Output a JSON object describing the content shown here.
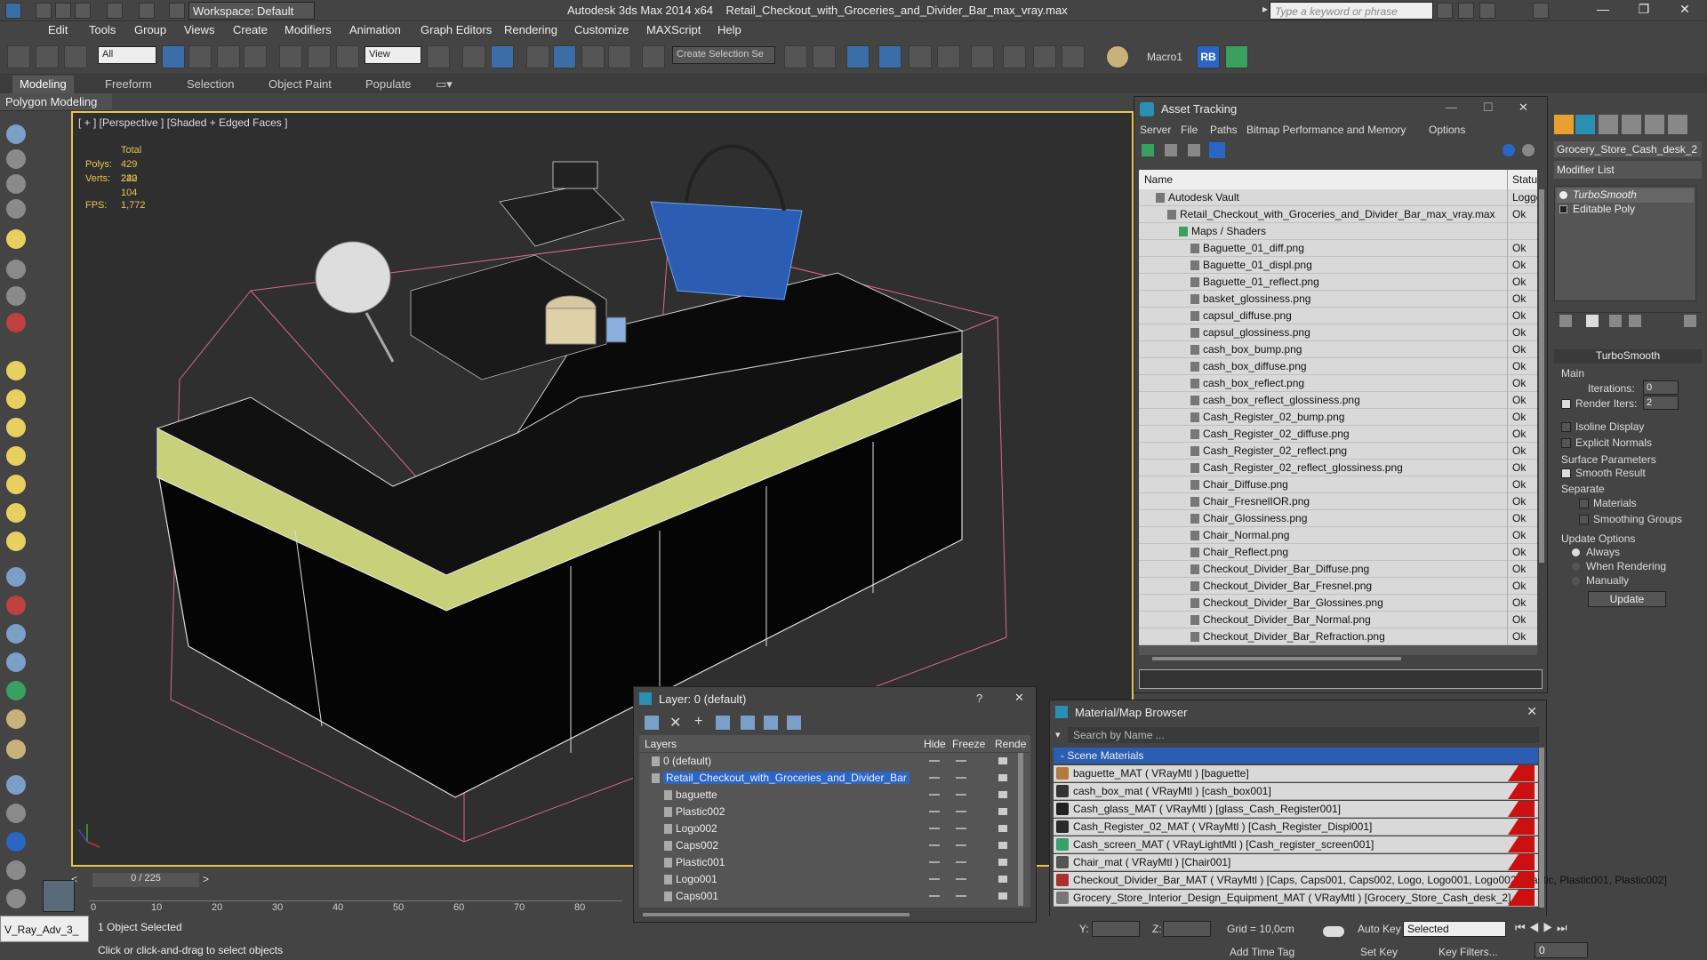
{
  "titlebar": {
    "app_title": "Autodesk 3ds Max  2014 x64",
    "file_title": "Retail_Checkout_with_Groceries_and_Divider_Bar_max_vray.max",
    "workspace": "Workspace: Default",
    "search_placeholder": "Type a keyword or phrase"
  },
  "menu": [
    "Edit",
    "Tools",
    "Group",
    "Views",
    "Create",
    "Modifiers",
    "Animation",
    "Graph Editors",
    "Rendering",
    "Customize",
    "MAXScript",
    "Help"
  ],
  "toolbar": {
    "selection_filter": "All",
    "ref_coord": "View",
    "named_selection_placeholder": "Create Selection Se",
    "macro_label": "Macro1",
    "rb_label": "RB"
  },
  "ribbon": {
    "tabs": [
      "Modeling",
      "Freeform",
      "Selection",
      "Object Paint",
      "Populate"
    ],
    "subtab": "Polygon Modeling"
  },
  "viewport": {
    "label": "[ + ] [Perspective ] [Shaded + Edged Faces ]",
    "stats_total": "Total",
    "polys_label": "Polys:",
    "polys_value": "429 242",
    "verts_label": "Verts:",
    "verts_value": "220 104",
    "fps_label": "FPS:",
    "fps_value": "1,772"
  },
  "asset_tracking": {
    "title": "Asset Tracking",
    "menu": [
      "Server",
      "File",
      "Paths",
      "Bitmap Performance and Memory",
      "Options"
    ],
    "col_name": "Name",
    "col_status": "Status",
    "rows": [
      {
        "name": "Autodesk Vault",
        "status": "Logge",
        "indent": 1
      },
      {
        "name": "Retail_Checkout_with_Groceries_and_Divider_Bar_max_vray.max",
        "status": "Ok",
        "indent": 2
      },
      {
        "name": "Maps / Shaders",
        "status": "",
        "indent": 3
      },
      {
        "name": "Baguette_01_diff.png",
        "status": "Ok",
        "indent": 4
      },
      {
        "name": "Baguette_01_displ.png",
        "status": "Ok",
        "indent": 4
      },
      {
        "name": "Baguette_01_reflect.png",
        "status": "Ok",
        "indent": 4
      },
      {
        "name": "basket_glossiness.png",
        "status": "Ok",
        "indent": 4
      },
      {
        "name": "capsul_diffuse.png",
        "status": "Ok",
        "indent": 4
      },
      {
        "name": "capsul_glossiness.png",
        "status": "Ok",
        "indent": 4
      },
      {
        "name": "cash_box_bump.png",
        "status": "Ok",
        "indent": 4
      },
      {
        "name": "cash_box_diffuse.png",
        "status": "Ok",
        "indent": 4
      },
      {
        "name": "cash_box_reflect.png",
        "status": "Ok",
        "indent": 4
      },
      {
        "name": "cash_box_reflect_glossiness.png",
        "status": "Ok",
        "indent": 4
      },
      {
        "name": "Cash_Register_02_bump.png",
        "status": "Ok",
        "indent": 4
      },
      {
        "name": "Cash_Register_02_diffuse.png",
        "status": "Ok",
        "indent": 4
      },
      {
        "name": "Cash_Register_02_reflect.png",
        "status": "Ok",
        "indent": 4
      },
      {
        "name": "Cash_Register_02_reflect_glossiness.png",
        "status": "Ok",
        "indent": 4
      },
      {
        "name": "Chair_Diffuse.png",
        "status": "Ok",
        "indent": 4
      },
      {
        "name": "Chair_FresnelIOR.png",
        "status": "Ok",
        "indent": 4
      },
      {
        "name": "Chair_Glossiness.png",
        "status": "Ok",
        "indent": 4
      },
      {
        "name": "Chair_Normal.png",
        "status": "Ok",
        "indent": 4
      },
      {
        "name": "Chair_Reflect.png",
        "status": "Ok",
        "indent": 4
      },
      {
        "name": "Checkout_Divider_Bar_Diffuse.png",
        "status": "Ok",
        "indent": 4
      },
      {
        "name": "Checkout_Divider_Bar_Fresnel.png",
        "status": "Ok",
        "indent": 4
      },
      {
        "name": "Checkout_Divider_Bar_Glossines.png",
        "status": "Ok",
        "indent": 4
      },
      {
        "name": "Checkout_Divider_Bar_Normal.png",
        "status": "Ok",
        "indent": 4
      },
      {
        "name": "Checkout_Divider_Bar_Refraction.png",
        "status": "Ok",
        "indent": 4
      }
    ]
  },
  "command_panel": {
    "object_name": "Grocery_Store_Cash_desk_2",
    "modifier_list": "Modifier List",
    "stack": [
      "TurboSmooth",
      "Editable Poly"
    ],
    "turbosmooth_title": "TurboSmooth",
    "main_label": "Main",
    "iterations_label": "Iterations:",
    "iterations_value": "0",
    "render_iters_label": "Render Iters:",
    "render_iters_value": "2",
    "isoline_label": "Isoline Display",
    "explicit_label": "Explicit Normals",
    "surface_label": "Surface Parameters",
    "smooth_label": "Smooth Result",
    "separate_label": "Separate",
    "materials_label": "Materials",
    "smoothing_label": "Smoothing Groups",
    "update_options_label": "Update Options",
    "always_label": "Always",
    "when_rendering_label": "When Rendering",
    "manually_label": "Manually",
    "update_button": "Update"
  },
  "layer_dialog": {
    "title": "Layer: 0 (default)",
    "help": "?",
    "col_layers": "Layers",
    "col_hide": "Hide",
    "col_freeze": "Freeze",
    "col_render": "Rende",
    "rows": [
      {
        "name": "0 (default)",
        "indent": 1,
        "selected": false
      },
      {
        "name": "Retail_Checkout_with_Groceries_and_Divider_Bar",
        "indent": 1,
        "selected": true
      },
      {
        "name": "baguette",
        "indent": 2,
        "selected": false
      },
      {
        "name": "Plastic002",
        "indent": 2,
        "selected": false
      },
      {
        "name": "Logo002",
        "indent": 2,
        "selected": false
      },
      {
        "name": "Caps002",
        "indent": 2,
        "selected": false
      },
      {
        "name": "Plastic001",
        "indent": 2,
        "selected": false
      },
      {
        "name": "Logo001",
        "indent": 2,
        "selected": false
      },
      {
        "name": "Caps001",
        "indent": 2,
        "selected": false
      }
    ]
  },
  "material_browser": {
    "title": "Material/Map Browser",
    "search_placeholder": "Search by Name ...",
    "group": "- Scene Materials",
    "rows": [
      {
        "name": "baguette_MAT ( VRayMtl ) [baguette]",
        "color": "#b07a40"
      },
      {
        "name": "cash_box_mat  ( VRayMtl ) [cash_box001]",
        "color": "#333333"
      },
      {
        "name": "Cash_glass_MAT ( VRayMtl ) [glass_Cash_Register001]",
        "color": "#222222"
      },
      {
        "name": "Cash_Register_02_MAT ( VRayMtl ) [Cash_Register_Displ001]",
        "color": "#2a2a2a"
      },
      {
        "name": "Cash_screen_MAT ( VRayLightMtl ) [Cash_register_screen001]",
        "color": "#3aa06a"
      },
      {
        "name": "Chair_mat  ( VRayMtl ) [Chair001]",
        "color": "#555555"
      },
      {
        "name": "Checkout_Divider_Bar_MAT ( VRayMtl ) [Caps, Caps001, Caps002, Logo, Logo001, Logo002, Plastic, Plastic001, Plastic002]",
        "color": "#aa3030"
      },
      {
        "name": "Grocery_Store_Interior_Design_Equipment_MAT ( VRayMtl ) [Grocery_Store_Cash_desk_2]",
        "color": "#777777"
      }
    ]
  },
  "timeline": {
    "frame": "0 / 225",
    "ticks": [
      "0",
      "10",
      "20",
      "30",
      "40",
      "50",
      "60",
      "70",
      "80"
    ]
  },
  "status": {
    "renderer": "V_Ray_Adv_3_",
    "selected": "1 Object Selected",
    "prompt": "Click or click-and-drag to select objects",
    "y_label": "Y:",
    "z_label": "Z:",
    "grid": "Grid = 10,0cm",
    "add_time_tag": "Add Time Tag",
    "auto_key": "Auto Key",
    "set_key": "Set Key",
    "selected_dropdown": "Selected",
    "key_filters": "Key Filters...",
    "frame_field": "0"
  },
  "colors": {
    "accent_blue": "#2b65c6",
    "viewport_border": "#e8c450",
    "divider_bar_yellow": "#c8d07a"
  }
}
